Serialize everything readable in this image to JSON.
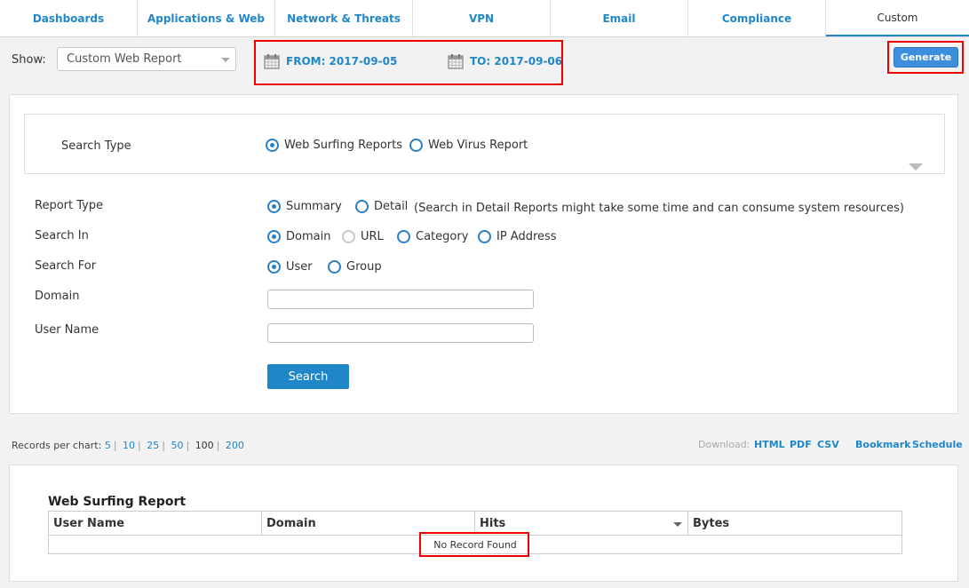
{
  "tabs": [
    "Dashboards",
    "Applications & Web",
    "Network & Threats",
    "VPN",
    "Email",
    "Compliance",
    "Custom"
  ],
  "filter": {
    "show_label": "Show:",
    "show_value": "Custom Web Report",
    "from": "FROM: 2017-09-05",
    "to": "TO: 2017-09-06",
    "generate": "Generate"
  },
  "search_type": {
    "label": "Search Type",
    "options": [
      "Web Surfing Reports",
      "Web Virus Report"
    ]
  },
  "form": {
    "report_type_label": "Report Type",
    "report_type_options": [
      "Summary",
      "Detail"
    ],
    "detail_note": "(Search in Detail Reports might take some time and can consume system resources)",
    "search_in_label": "Search In",
    "search_in_options": [
      "Domain",
      "URL",
      "Category",
      "IP Address"
    ],
    "search_for_label": "Search For",
    "search_for_options": [
      "User",
      "Group"
    ],
    "domain_label": "Domain",
    "username_label": "User Name",
    "search_button": "Search"
  },
  "records": {
    "label": "Records per chart:",
    "options": [
      "5",
      "10",
      "25",
      "50",
      "100",
      "200"
    ],
    "selected": "100"
  },
  "download": {
    "label": "Download:",
    "html": "HTML",
    "pdf": "PDF",
    "csv": "CSV",
    "bookmark": "Bookmark",
    "schedule": "Schedule"
  },
  "report": {
    "title": "Web Surfing Report",
    "columns": [
      "User Name",
      "Domain",
      "Hits",
      "Bytes"
    ],
    "empty": "No Record Found"
  },
  "colors": {
    "accent": "#1f87c8",
    "highlight": "#e00000"
  }
}
